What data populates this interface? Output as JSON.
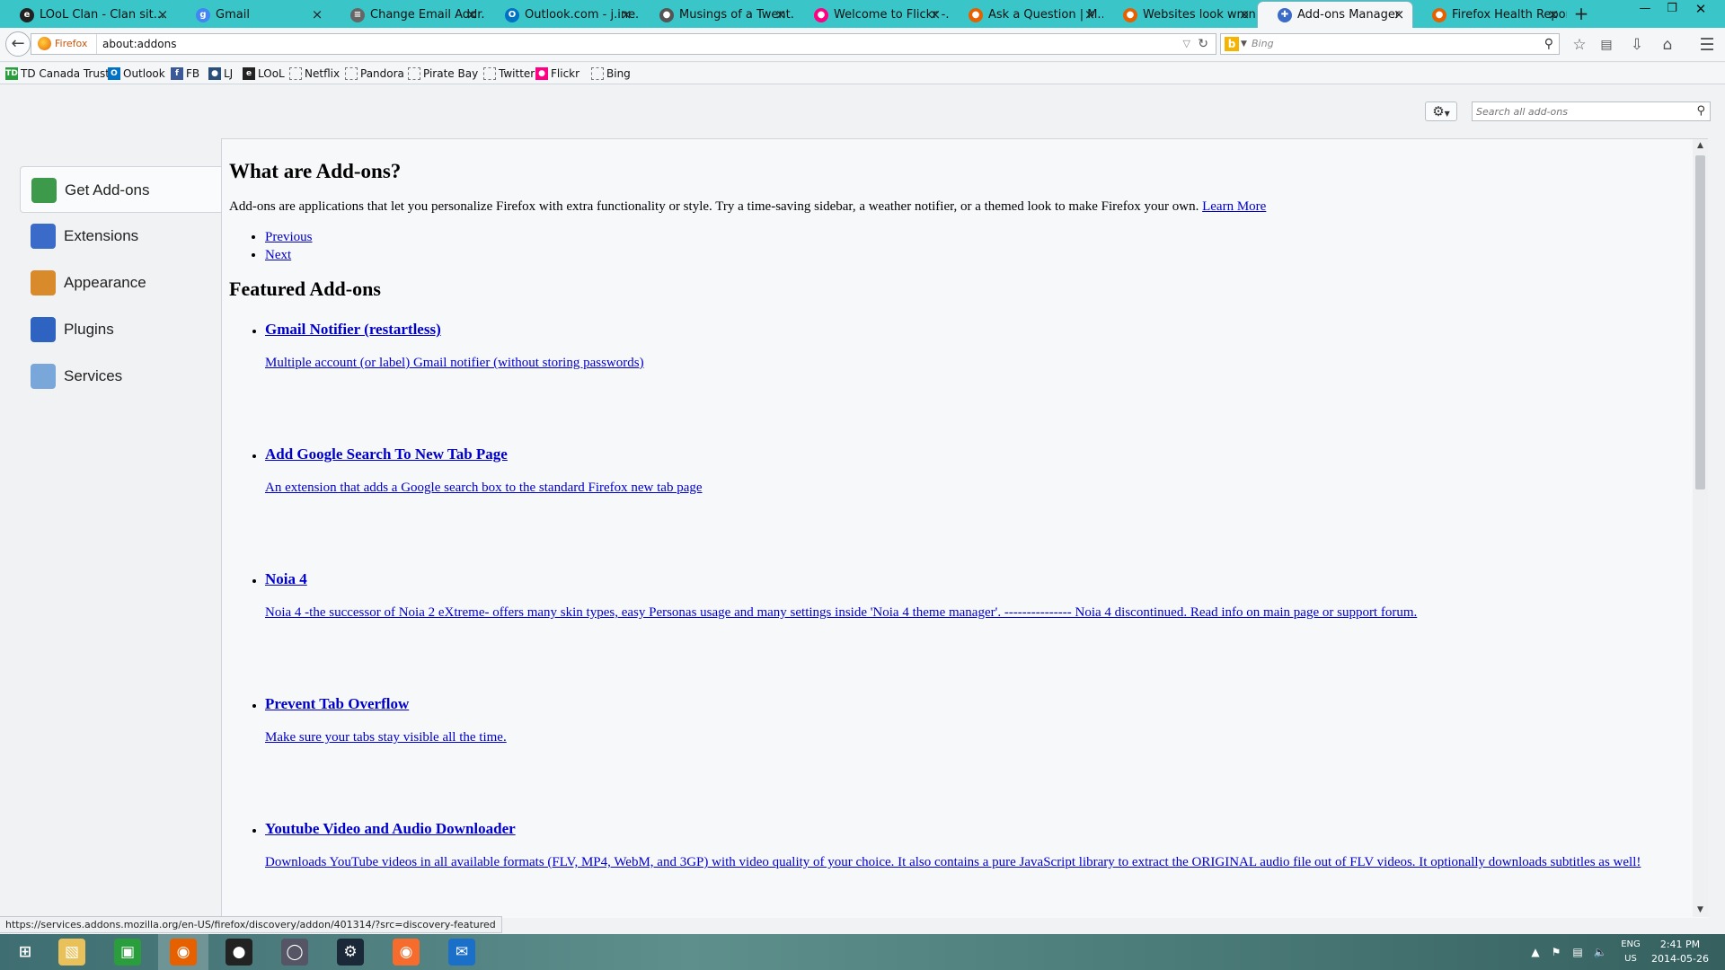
{
  "tabs": [
    {
      "label": "LOoL Clan - Clan sit...",
      "icon": "lool-logo-icon",
      "color": "#222"
    },
    {
      "label": "Gmail",
      "icon": "google-plus-icon",
      "color": "#4285f4"
    },
    {
      "label": "Change Email Addr...",
      "icon": "paperclip-icon",
      "color": "#666"
    },
    {
      "label": "Outlook.com - j.ine...",
      "icon": "outlook-icon",
      "color": "#0072c6"
    },
    {
      "label": "Musings of a Twent...",
      "icon": "user-icon",
      "color": "#555"
    },
    {
      "label": "Welcome to Flickr -...",
      "icon": "flickr-icon",
      "color": "#ff0084"
    },
    {
      "label": "Ask a Question | M...",
      "icon": "firefox-icon",
      "color": "#e66000"
    },
    {
      "label": "Websites look wron...",
      "icon": "firefox-icon",
      "color": "#e66000"
    },
    {
      "label": "Add-ons Manager",
      "icon": "puzzle-icon",
      "color": "#3a6bc9",
      "active": true
    },
    {
      "label": "Firefox Health Report",
      "icon": "firefox-icon",
      "color": "#e66000"
    }
  ],
  "nav": {
    "identity_label": "Firefox",
    "url": "about:addons",
    "search_placeholder": "Bing"
  },
  "bookmarks": [
    {
      "label": "TD Canada Trust",
      "icon": "td-icon",
      "color": "#2a9d3c"
    },
    {
      "label": "Outlook",
      "icon": "outlook-icon",
      "color": "#0072c6"
    },
    {
      "label": "FB",
      "icon": "facebook-icon",
      "color": "#3b5998"
    },
    {
      "label": "LJ",
      "icon": "livejournal-icon",
      "color": "#2a4f7a"
    },
    {
      "label": "LOoL",
      "icon": "lool-logo-icon",
      "color": "#222"
    },
    {
      "label": "Netflix",
      "icon": "blank-page-icon",
      "blank": true
    },
    {
      "label": "Pandora",
      "icon": "blank-page-icon",
      "blank": true
    },
    {
      "label": "Pirate Bay",
      "icon": "blank-page-icon",
      "blank": true
    },
    {
      "label": "Twitter",
      "icon": "blank-page-icon",
      "blank": true
    },
    {
      "label": "Flickr",
      "icon": "flickr-icon",
      "color": "#ff0084"
    },
    {
      "label": "Bing",
      "icon": "blank-page-icon",
      "blank": true
    }
  ],
  "addons": {
    "search_placeholder": "Search all add-ons",
    "categories": [
      {
        "label": "Get Add-ons",
        "icon": "get-addons-icon",
        "color": "#3d9a4a",
        "selected": true
      },
      {
        "label": "Extensions",
        "icon": "puzzle-icon",
        "color": "#3a6bc9"
      },
      {
        "label": "Appearance",
        "icon": "paintbrush-icon",
        "color": "#d98a2b"
      },
      {
        "label": "Plugins",
        "icon": "plugin-icon",
        "color": "#2f63c2"
      },
      {
        "label": "Services",
        "icon": "speech-bubble-icon",
        "color": "#7aa7d9"
      }
    ],
    "content": {
      "heading": "What are Add-ons?",
      "intro": "Add-ons are applications that let you personalize Firefox with extra functionality or style. Try a time-saving sidebar, a weather notifier, or a themed look to make Firefox your own.",
      "learn_more": "Learn More",
      "previous": "Previous",
      "next": "Next",
      "featured_heading": "Featured Add-ons",
      "featured": [
        {
          "title": "Gmail Notifier (restartless)",
          "description": "Multiple account (or label) Gmail notifier (without storing passwords)"
        },
        {
          "title": "Add Google Search To New Tab Page",
          "description": "An extension that adds a Google search box to the standard Firefox new tab page"
        },
        {
          "title": "Noia 4",
          "description": "Noia 4 -the successor of Noia 2 eXtreme- offers many skin types, easy Personas usage and many settings inside 'Noia 4 theme manager'. --------------- Noia 4 discontinued. Read info on main page or support forum."
        },
        {
          "title": "Prevent Tab Overflow",
          "description": "Make sure your tabs stay visible all the time."
        },
        {
          "title": "Youtube Video and Audio Downloader",
          "description": "Downloads YouTube videos in all available formats (FLV, MP4, WebM, and 3GP) with video quality of your choice. It also contains a pure JavaScript library to extract the ORIGINAL audio file out of FLV videos. It optionally downloads subtitles as well!"
        }
      ]
    }
  },
  "status_url": "https://services.addons.mozilla.org/en-US/firefox/discovery/addon/401314/?src=discovery-featured",
  "taskbar": {
    "apps": [
      {
        "icon": "windows-start-icon"
      },
      {
        "icon": "file-explorer-icon"
      },
      {
        "icon": "store-icon"
      },
      {
        "icon": "firefox-icon",
        "active": true
      },
      {
        "icon": "owl-app-icon"
      },
      {
        "icon": "disc-app-icon"
      },
      {
        "icon": "steam-icon"
      },
      {
        "icon": "origin-icon"
      },
      {
        "icon": "mail-icon"
      }
    ],
    "lang_top": "ENG",
    "lang_bottom": "US",
    "time": "2:41 PM",
    "date": "2014-05-26"
  }
}
